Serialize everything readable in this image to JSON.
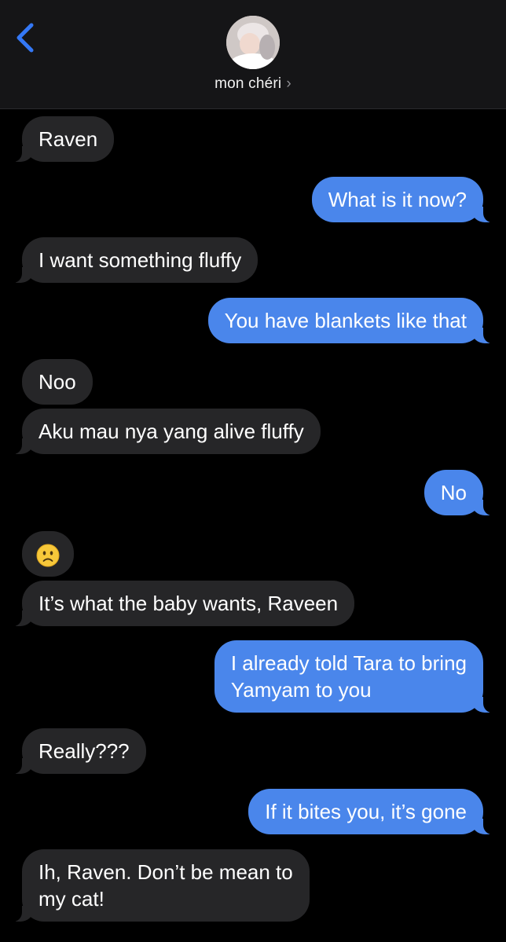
{
  "header": {
    "contact_name": "mon chéri",
    "chevron": "›",
    "back_icon": "chevron-left-icon",
    "accent": "#3478f6"
  },
  "messages": [
    {
      "from": "them",
      "text": "Raven"
    },
    {
      "from": "me",
      "text": "What is it now?"
    },
    {
      "from": "them",
      "text": "I want something fluffy"
    },
    {
      "from": "me",
      "text": "You have blankets like that"
    },
    {
      "from": "them",
      "text": "Noo"
    },
    {
      "from": "them",
      "text": "Aku mau nya yang alive fluffy"
    },
    {
      "from": "me",
      "text": "No"
    },
    {
      "from": "them",
      "emoji": "slightly-frowning-face-emoji"
    },
    {
      "from": "them",
      "text": "It’s what the baby wants, Raveen"
    },
    {
      "from": "me",
      "lines": [
        "I already told Tara to bring",
        "Yamyam to you"
      ]
    },
    {
      "from": "them",
      "text": "Really???"
    },
    {
      "from": "me",
      "text": "If it bites you, it’s gone"
    },
    {
      "from": "them",
      "lines": [
        "Ih, Raven. Don’t be mean to",
        "my cat!"
      ]
    }
  ],
  "colors": {
    "sent_bubble": "#4a86eb",
    "received_bubble": "#262628",
    "background": "#000000",
    "header_bg": "#151517"
  }
}
